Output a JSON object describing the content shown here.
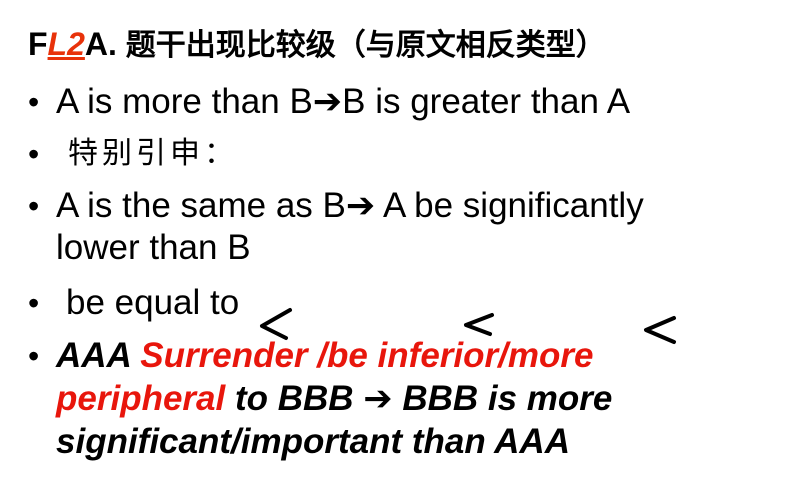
{
  "title": {
    "prefix": "F",
    "middle": "L2",
    "suffix": "A.",
    "chinese": "题干出现比较级（与原文相反类型）"
  },
  "bullets": {
    "b1": {
      "a": "A is more than B",
      "arrow": "➔",
      "b": "B is greater than A"
    },
    "b2": {
      "text": "特别引申："
    },
    "b3": {
      "a": "A is the same as B",
      "arrow": "➔",
      "b": " A be significantly",
      "line2": "lower than B"
    },
    "b4": {
      "text": "be equal to"
    },
    "b5": {
      "part1": "AAA ",
      "part2": "Surrender /be inferior/more",
      "part3": "peripheral",
      "part4": "  to  BBB ",
      "arrow": "➔",
      "part5": "  BBB is more",
      "line3": "significant/important than AAA"
    }
  },
  "bullet_symbol": "•",
  "colors": {
    "accent": "#e8160c",
    "text": "#000000"
  },
  "annotations": [
    "<",
    "<",
    "<"
  ]
}
